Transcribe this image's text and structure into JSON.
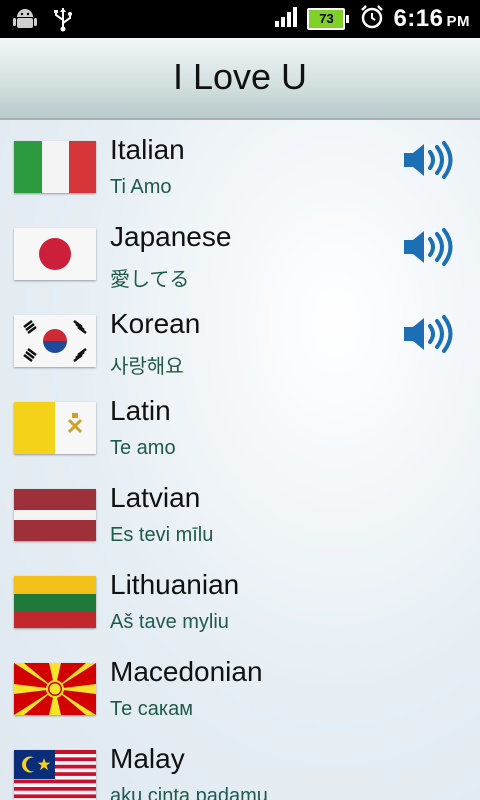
{
  "status": {
    "battery": "73",
    "time": "6:16",
    "ampm": "PM"
  },
  "header": {
    "title": "I Love U"
  },
  "languages": [
    {
      "name": "Italian",
      "phrase": "Ti Amo",
      "audio": true
    },
    {
      "name": "Japanese",
      "phrase": "愛してる",
      "audio": true
    },
    {
      "name": "Korean",
      "phrase": "사랑해요",
      "audio": true
    },
    {
      "name": "Latin",
      "phrase": "Te amo",
      "audio": false
    },
    {
      "name": "Latvian",
      "phrase": "Es tevi mīlu",
      "audio": false
    },
    {
      "name": "Lithuanian",
      "phrase": "Aš tave myliu",
      "audio": false
    },
    {
      "name": "Macedonian",
      "phrase": "Те сакам",
      "audio": false
    },
    {
      "name": "Malay",
      "phrase": "aku cinta padamu",
      "audio": false
    }
  ],
  "colors": {
    "accent_speaker": "#1c6fb5",
    "phrase_text": "#1f5a4a"
  }
}
